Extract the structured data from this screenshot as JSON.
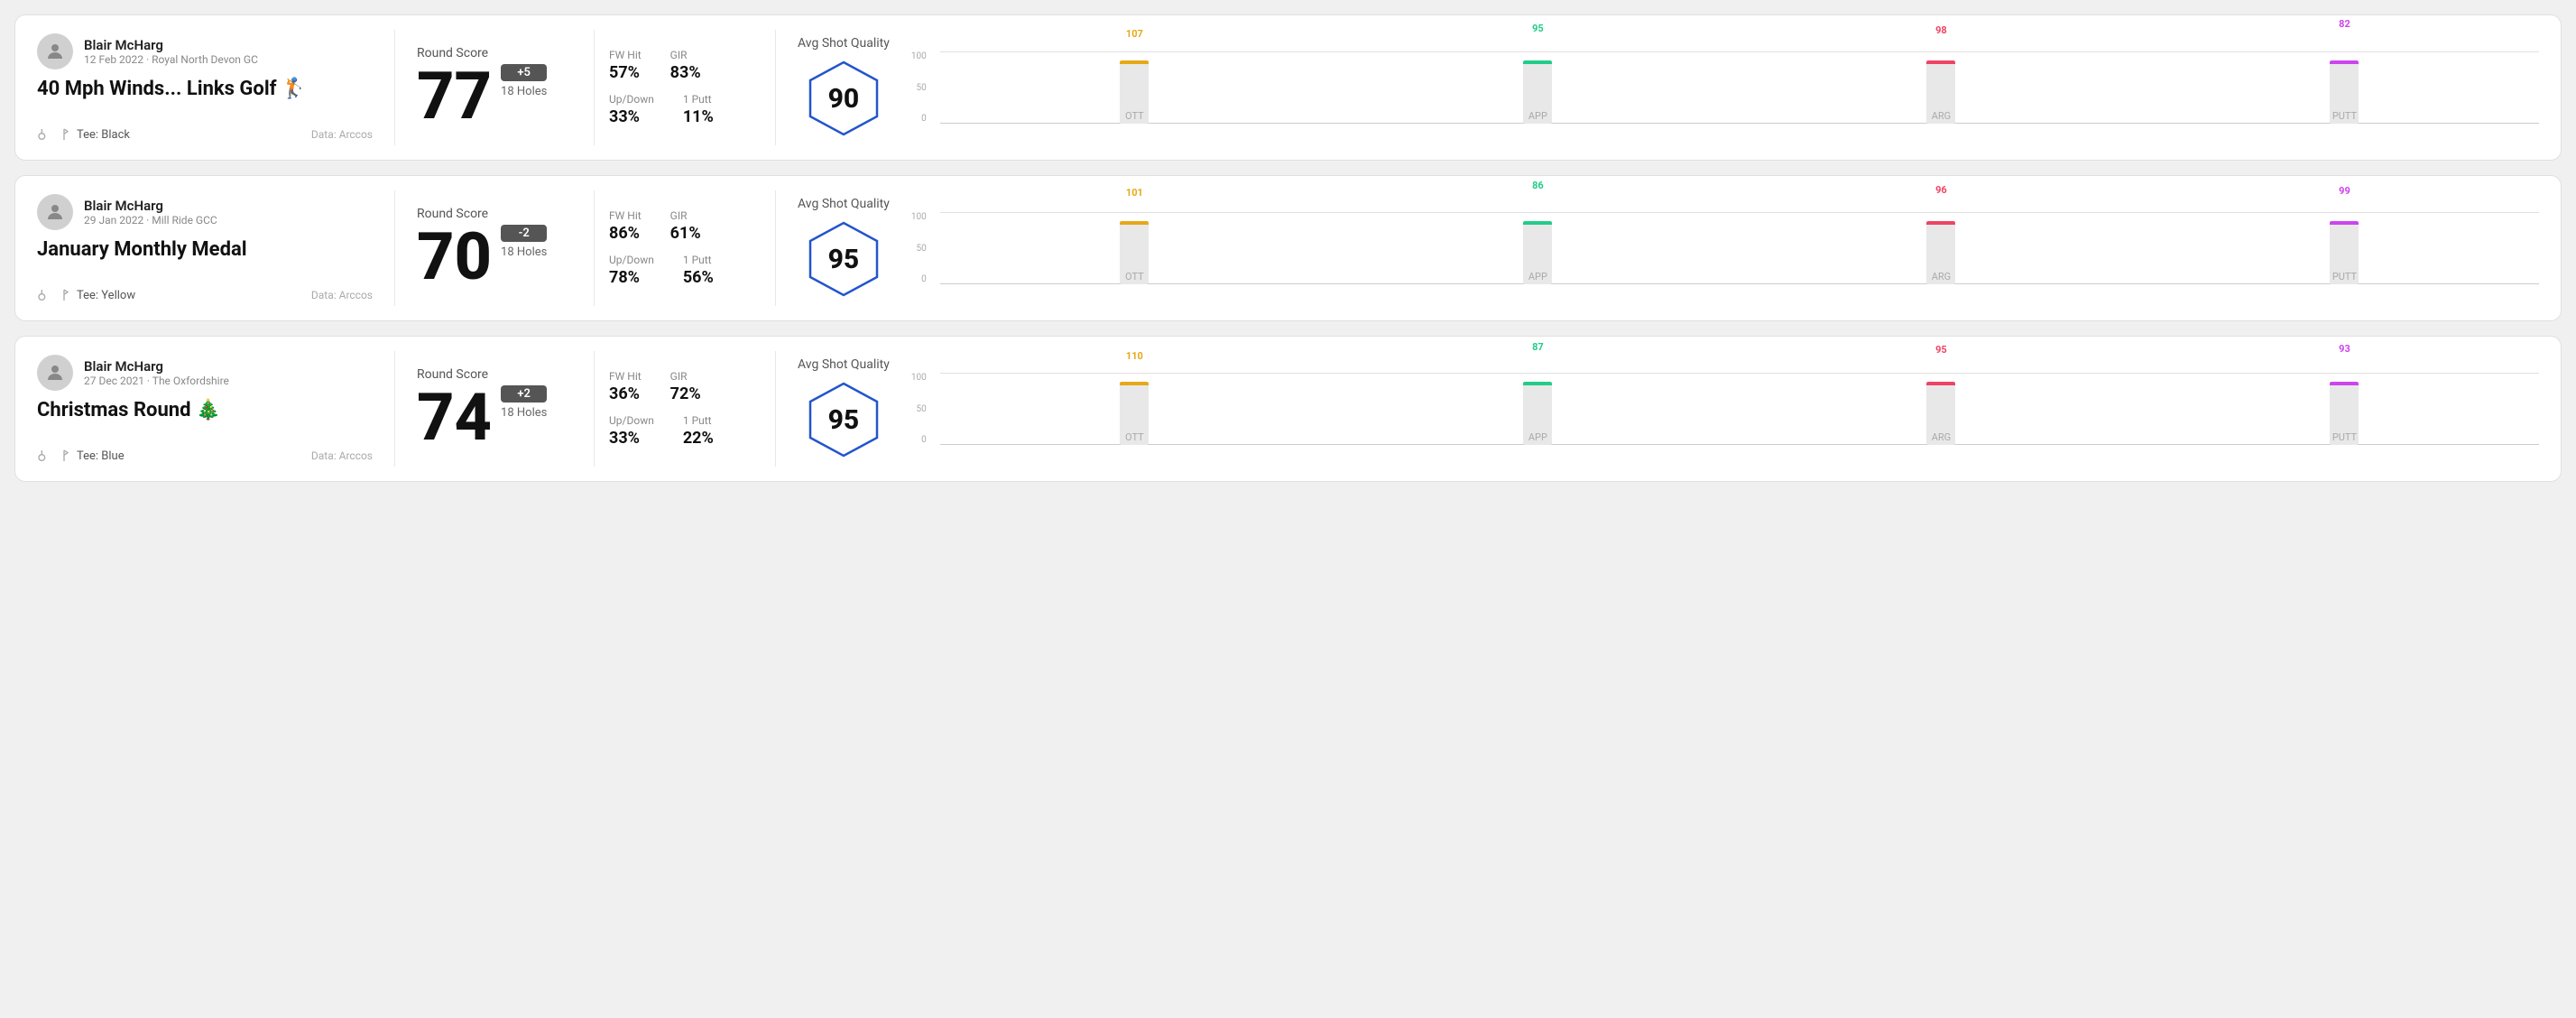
{
  "rounds": [
    {
      "id": "round-1",
      "user": {
        "name": "Blair McHarg",
        "meta": "12 Feb 2022 · Royal North Devon GC"
      },
      "title": "40 Mph Winds... Links Golf 🏌️",
      "tee": "Tee: Black",
      "data_source": "Data: Arccos",
      "score": {
        "label": "Round Score",
        "number": "77",
        "badge": "+5",
        "badge_type": "positive",
        "holes": "18 Holes"
      },
      "stats": [
        {
          "label": "FW Hit",
          "value": "57%"
        },
        {
          "label": "GIR",
          "value": "83%"
        },
        {
          "label": "Up/Down",
          "value": "33%"
        },
        {
          "label": "1 Putt",
          "value": "11%"
        }
      ],
      "quality": {
        "label": "Avg Shot Quality",
        "score": "90"
      },
      "chart": {
        "bars": [
          {
            "key": "OTT",
            "value": 107,
            "height_pct": 72,
            "color_class": "bar-ott"
          },
          {
            "key": "APP",
            "value": 95,
            "height_pct": 63,
            "color_class": "bar-app"
          },
          {
            "key": "ARG",
            "value": 98,
            "height_pct": 65,
            "color_class": "bar-arg"
          },
          {
            "key": "PUTT",
            "value": 82,
            "height_pct": 55,
            "color_class": "bar-putt"
          }
        ]
      }
    },
    {
      "id": "round-2",
      "user": {
        "name": "Blair McHarg",
        "meta": "29 Jan 2022 · Mill Ride GCC"
      },
      "title": "January Monthly Medal",
      "tee": "Tee: Yellow",
      "data_source": "Data: Arccos",
      "score": {
        "label": "Round Score",
        "number": "70",
        "badge": "-2",
        "badge_type": "negative",
        "holes": "18 Holes"
      },
      "stats": [
        {
          "label": "FW Hit",
          "value": "86%"
        },
        {
          "label": "GIR",
          "value": "61%"
        },
        {
          "label": "Up/Down",
          "value": "78%"
        },
        {
          "label": "1 Putt",
          "value": "56%"
        }
      ],
      "quality": {
        "label": "Avg Shot Quality",
        "score": "95"
      },
      "chart": {
        "bars": [
          {
            "key": "OTT",
            "value": 101,
            "height_pct": 68,
            "color_class": "bar-ott"
          },
          {
            "key": "APP",
            "value": 86,
            "height_pct": 57,
            "color_class": "bar-app"
          },
          {
            "key": "ARG",
            "value": 96,
            "height_pct": 64,
            "color_class": "bar-arg"
          },
          {
            "key": "PUTT",
            "value": 99,
            "height_pct": 66,
            "color_class": "bar-putt"
          }
        ]
      }
    },
    {
      "id": "round-3",
      "user": {
        "name": "Blair McHarg",
        "meta": "27 Dec 2021 · The Oxfordshire"
      },
      "title": "Christmas Round 🎄",
      "tee": "Tee: Blue",
      "data_source": "Data: Arccos",
      "score": {
        "label": "Round Score",
        "number": "74",
        "badge": "+2",
        "badge_type": "positive",
        "holes": "18 Holes"
      },
      "stats": [
        {
          "label": "FW Hit",
          "value": "36%"
        },
        {
          "label": "GIR",
          "value": "72%"
        },
        {
          "label": "Up/Down",
          "value": "33%"
        },
        {
          "label": "1 Putt",
          "value": "22%"
        }
      ],
      "quality": {
        "label": "Avg Shot Quality",
        "score": "95"
      },
      "chart": {
        "bars": [
          {
            "key": "OTT",
            "value": 110,
            "height_pct": 73,
            "color_class": "bar-ott"
          },
          {
            "key": "APP",
            "value": 87,
            "height_pct": 58,
            "color_class": "bar-app"
          },
          {
            "key": "ARG",
            "value": 95,
            "height_pct": 63,
            "color_class": "bar-arg"
          },
          {
            "key": "PUTT",
            "value": 93,
            "height_pct": 62,
            "color_class": "bar-putt"
          }
        ]
      }
    }
  ],
  "y_axis_labels": [
    "100",
    "50",
    "0"
  ]
}
